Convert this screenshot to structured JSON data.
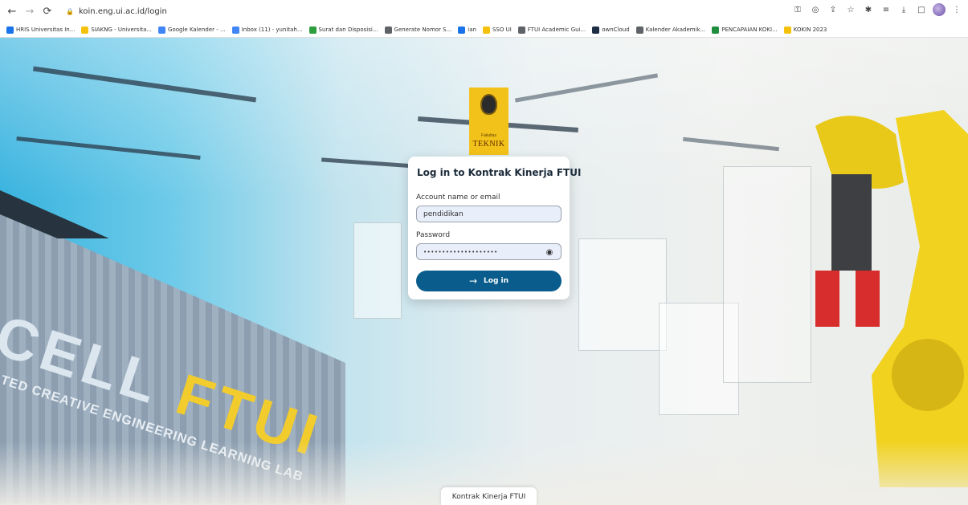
{
  "browser": {
    "url": "koin.eng.ui.ac.id/login",
    "bookmarks": [
      {
        "label": "HRIS Universitas In...",
        "color": "#1a73e8"
      },
      {
        "label": "SIAKNG - Universita...",
        "color": "#f4c20d"
      },
      {
        "label": "Google Kalender - ...",
        "color": "#4285f4"
      },
      {
        "label": "Inbox (11) - yunitah...",
        "color": "#4285f4"
      },
      {
        "label": "Surat dan Disposisi...",
        "color": "#2e9e3e"
      },
      {
        "label": "Generate Nomor S...",
        "color": "#5f6368"
      },
      {
        "label": "ian",
        "color": "#1a73e8"
      },
      {
        "label": "SSO UI",
        "color": "#f4c20d"
      },
      {
        "label": "FTUI Academic Gui...",
        "color": "#5f6368"
      },
      {
        "label": "ownCloud",
        "color": "#1d2d44"
      },
      {
        "label": "Kalender Akademik...",
        "color": "#5f6368"
      },
      {
        "label": "PENCAPAIAN KOKI...",
        "color": "#1e8e3e"
      },
      {
        "label": "KOKIN 2023",
        "color": "#f4c20d"
      }
    ]
  },
  "building_sign": {
    "line1_prefix": "CELL ",
    "line1_accent": "FTUI",
    "line2": "TED CREATIVE ENGINEERING LEARNING LAB"
  },
  "logo": {
    "subtitle": "Fakultas",
    "text": "TEKNIK"
  },
  "login": {
    "title": "Log in to Kontrak Kinerja FTUI",
    "account_label": "Account name or email",
    "account_value": "pendidikan",
    "password_label": "Password",
    "password_value": "••••••••••••••••••••",
    "button_label": "Log in"
  },
  "footer": {
    "label": "Kontrak Kinerja FTUI"
  },
  "colors": {
    "primary": "#0a5c8c",
    "logo_yellow": "#f3c21a",
    "input_bg": "#e8eefa"
  }
}
